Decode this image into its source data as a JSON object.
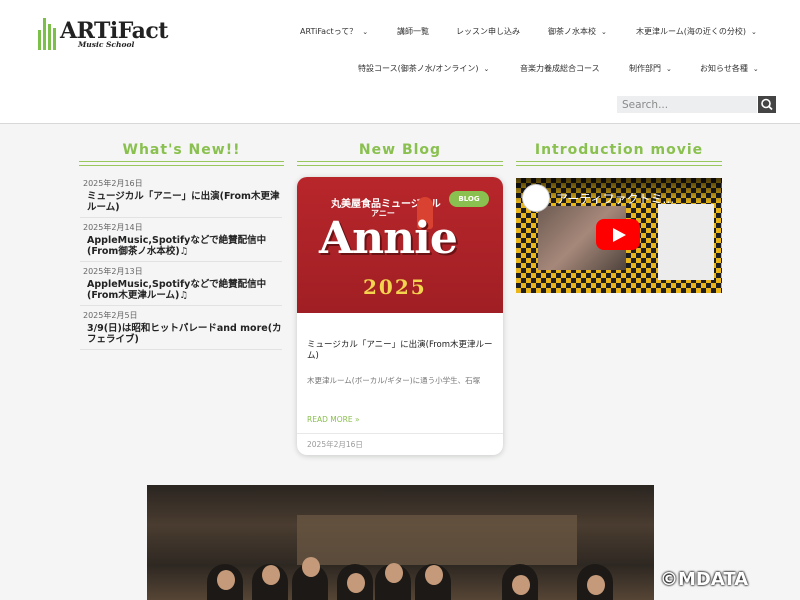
{
  "header": {
    "logo_text": "ARTiFact",
    "logo_sub": "Music School",
    "nav_row1": [
      {
        "label": "ARTiFactって？",
        "has_dropdown": true
      },
      {
        "label": "講師一覧",
        "has_dropdown": false
      },
      {
        "label": "レッスン申し込み",
        "has_dropdown": false
      },
      {
        "label": "御茶ノ水本校",
        "has_dropdown": true
      },
      {
        "label": "木更津ルーム(海の近くの分校)",
        "has_dropdown": true
      }
    ],
    "nav_row2": [
      {
        "label": "特設コース(御茶ノ水/オンライン)",
        "has_dropdown": true
      },
      {
        "label": "音楽力養成総合コース",
        "has_dropdown": false
      },
      {
        "label": "制作部門",
        "has_dropdown": true
      },
      {
        "label": "お知らせ各種",
        "has_dropdown": true
      }
    ],
    "search": {
      "placeholder": "Search...",
      "icon": "search-icon"
    }
  },
  "sections": {
    "whats_new": "What's New!!",
    "new_blog": "New Blog",
    "intro_movie": "Introduction movie"
  },
  "news": [
    {
      "date": "2025年2月16日",
      "title": "ミュージカル「アニー」に出演(From木更津ルーム)"
    },
    {
      "date": "2025年2月14日",
      "title": "AppleMusic,Spotifyなどで絶賛配信中(From御茶ノ水本校)♫"
    },
    {
      "date": "2025年2月13日",
      "title": "AppleMusic,Spotifyなどで絶賛配信中(From木更津ルーム)♫"
    },
    {
      "date": "2025年2月5日",
      "title": "3/9(日)は昭和ヒットパレードand more(カフェライブ)"
    }
  ],
  "blog": {
    "badge": "BLOG",
    "image_caption1": "丸美屋食品ミュージカル",
    "image_caption2": "アニー",
    "image_title": "Annie",
    "image_year": "2025",
    "title": "ミュージカル「アニー」に出演(From木更津ルーム)",
    "excerpt": "木更津ルーム(ボーカル/ギター)に通う小学生、石塚",
    "read_more": "READ MORE »",
    "date": "2025年2月16日"
  },
  "video": {
    "title": "アーティファクトミ...",
    "play_icon": "play-icon"
  },
  "watermark": "©MDATA",
  "colors": {
    "accent_green": "#8ac04f",
    "youtube_red": "#ff0000"
  }
}
